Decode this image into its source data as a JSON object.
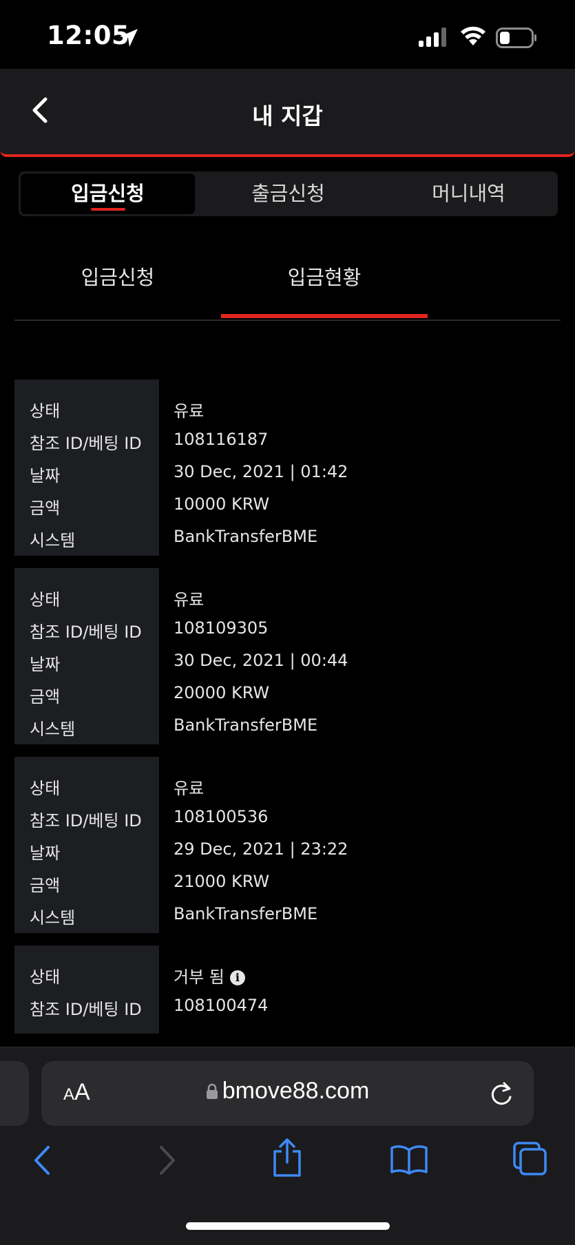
{
  "status_bar": {
    "time": "12:05"
  },
  "header": {
    "title": "내 지갑"
  },
  "main_tabs": [
    {
      "label": "입금신청",
      "active": true
    },
    {
      "label": "출금신청",
      "active": false
    },
    {
      "label": "머니내역",
      "active": false
    }
  ],
  "sub_tabs": [
    {
      "label": "입금신청",
      "active": false
    },
    {
      "label": "입금현황",
      "active": true
    }
  ],
  "records": [
    {
      "rows": [
        {
          "label": "상태",
          "value": "유료"
        },
        {
          "label": "참조 ID/베팅 ID",
          "value": "108116187"
        },
        {
          "label": "날짜",
          "value": "30 Dec, 2021 | 01:42"
        },
        {
          "label": "금액",
          "value": "10000 KRW"
        },
        {
          "label": "시스템",
          "value": "BankTransferBME"
        }
      ]
    },
    {
      "rows": [
        {
          "label": "상태",
          "value": "유료"
        },
        {
          "label": "참조 ID/베팅 ID",
          "value": "108109305"
        },
        {
          "label": "날짜",
          "value": "30 Dec, 2021 | 00:44"
        },
        {
          "label": "금액",
          "value": "20000 KRW"
        },
        {
          "label": "시스템",
          "value": "BankTransferBME"
        }
      ]
    },
    {
      "rows": [
        {
          "label": "상태",
          "value": "유료"
        },
        {
          "label": "참조 ID/베팅 ID",
          "value": "108100536"
        },
        {
          "label": "날짜",
          "value": "29 Dec, 2021 | 23:22"
        },
        {
          "label": "금액",
          "value": "21000 KRW"
        },
        {
          "label": "시스템",
          "value": "BankTransferBME"
        }
      ]
    },
    {
      "rows": [
        {
          "label": "상태",
          "value": "거부 됨"
        },
        {
          "label": "참조 ID/베팅 ID",
          "value": "108100474"
        }
      ]
    }
  ],
  "browser": {
    "aa_small": "A",
    "aa_big": "A",
    "url": "bmove88.com"
  },
  "colors": {
    "accent": "#e0261f",
    "link_blue": "#3e8af7",
    "panel": "#1d1e21"
  },
  "icons": [
    "location-arrow-icon",
    "cellular-signal-icon",
    "wifi-icon",
    "battery-icon",
    "back-chevron-icon",
    "info-icon",
    "lock-icon",
    "reload-icon",
    "browser-back-icon",
    "browser-forward-icon",
    "share-icon",
    "bookmarks-icon",
    "tabs-icon"
  ]
}
